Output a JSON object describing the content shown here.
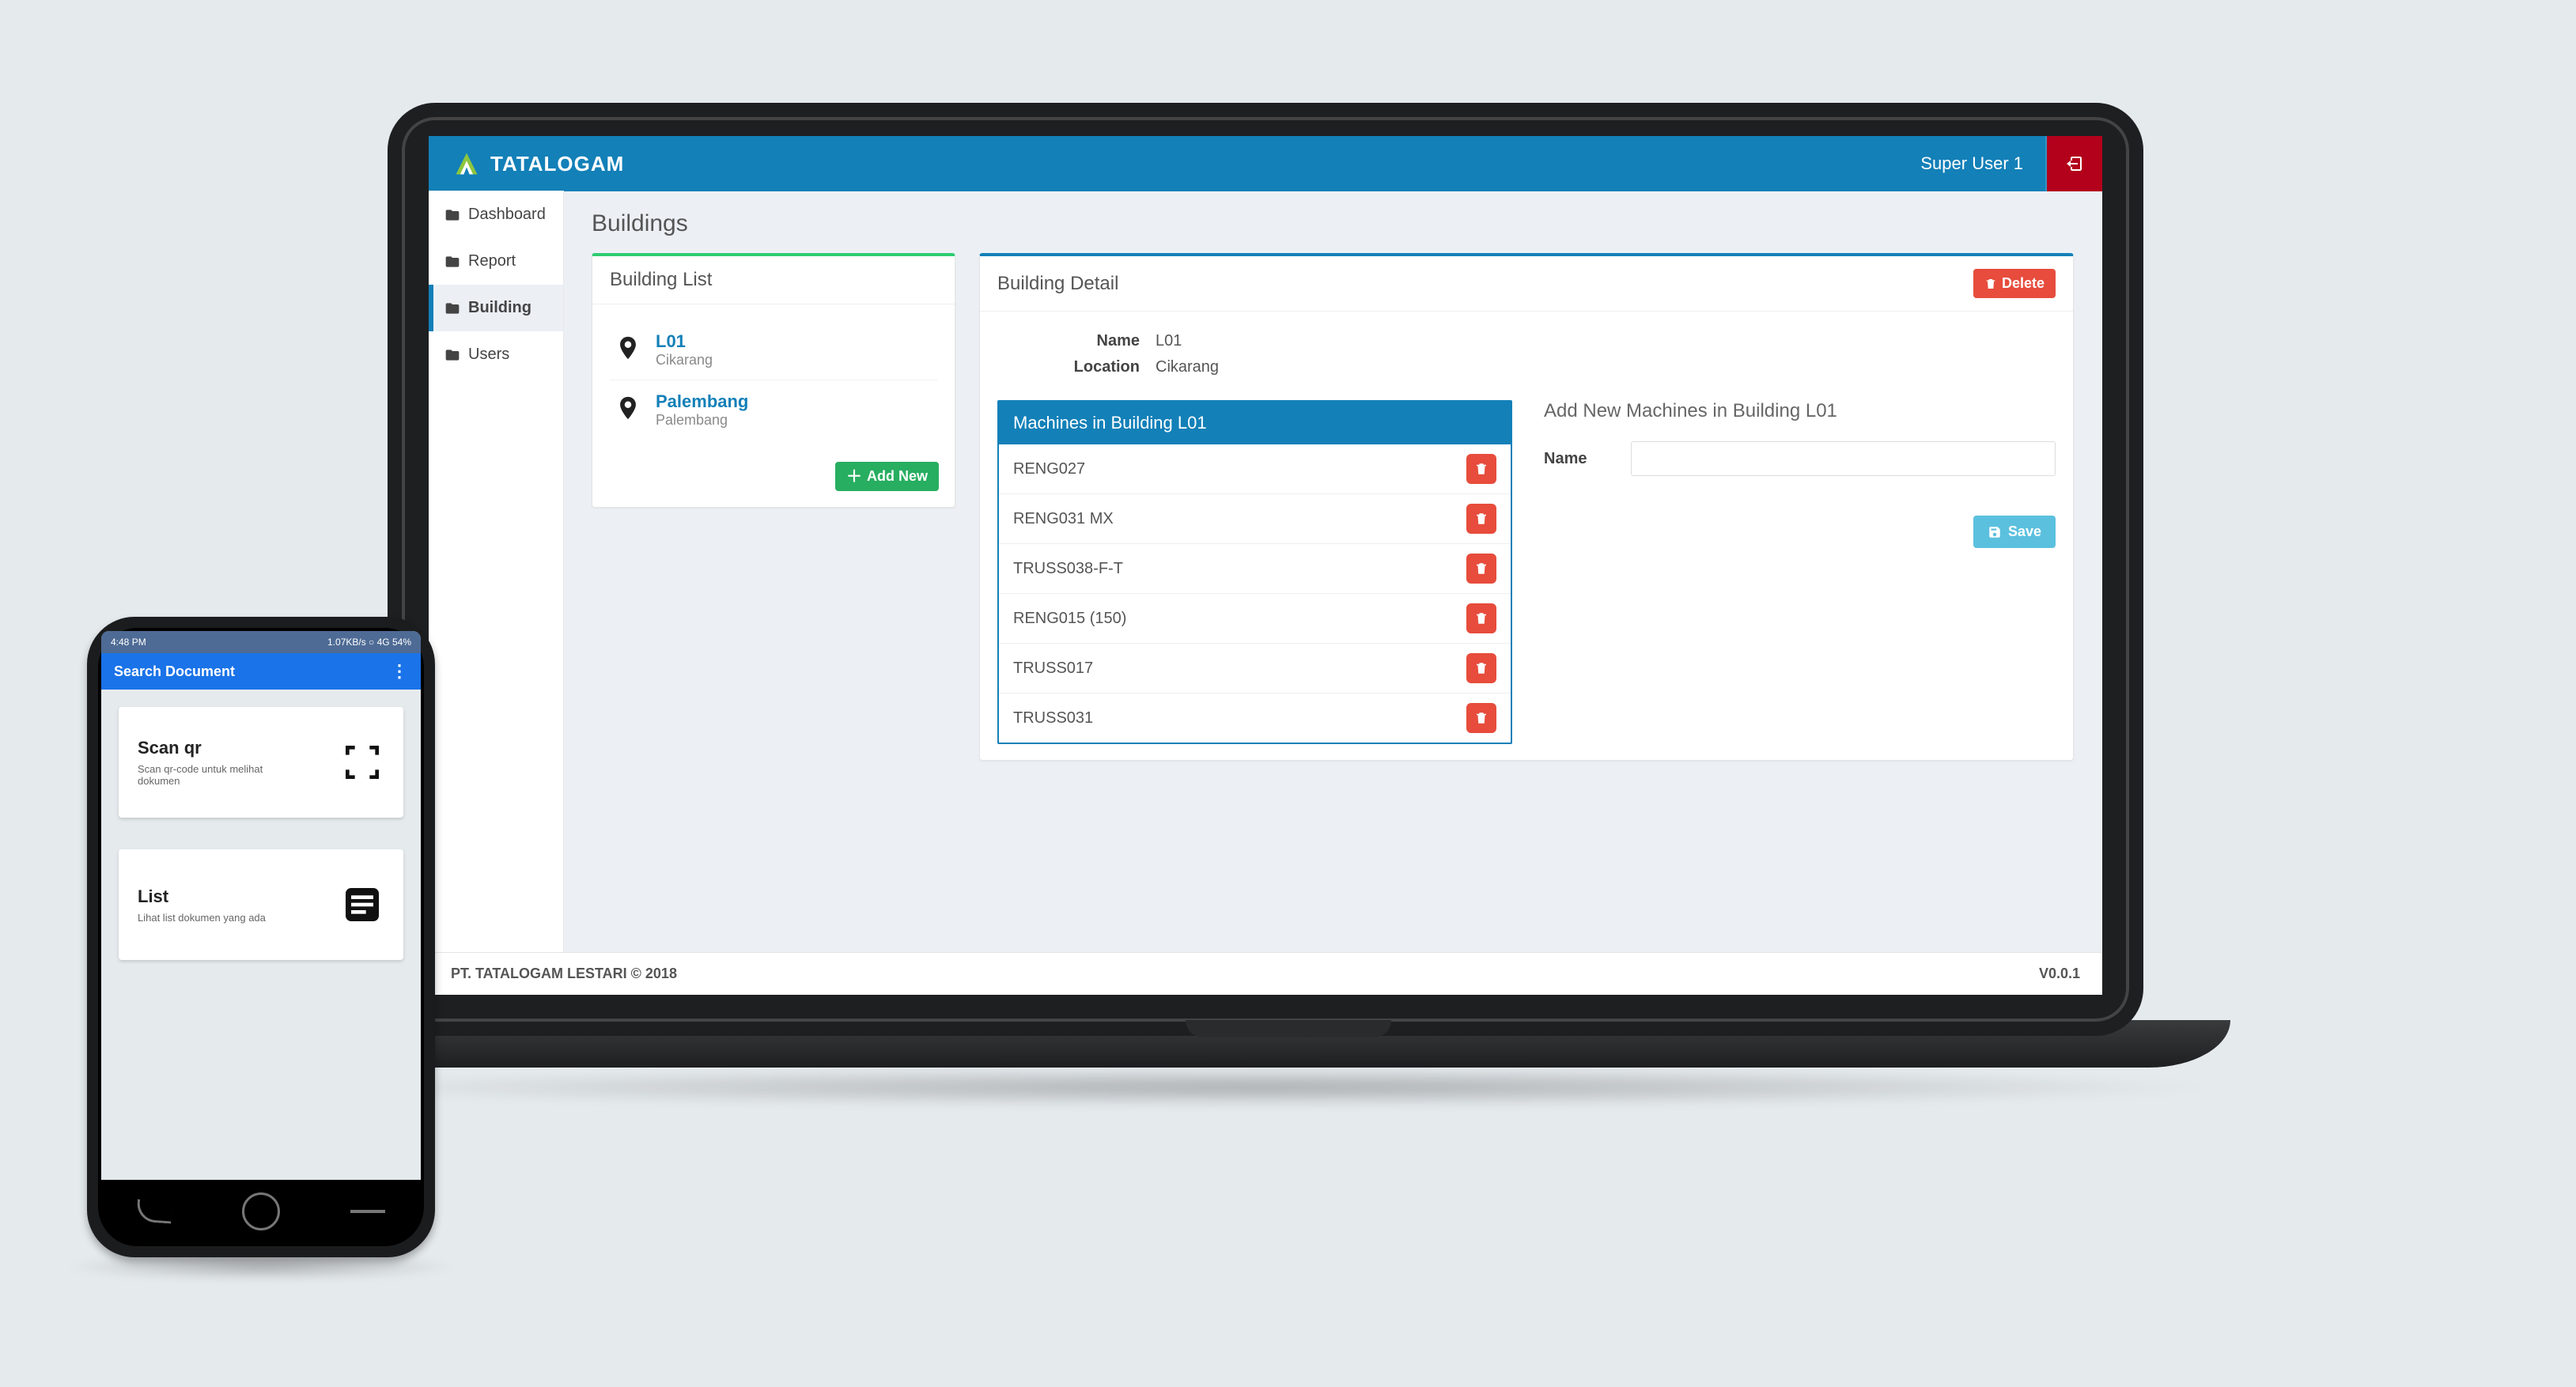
{
  "brand": "TATALOGAM",
  "topbar": {
    "user": "Super User 1"
  },
  "sidebar": [
    {
      "label": "Dashboard",
      "name": "dashboard"
    },
    {
      "label": "Report",
      "name": "report"
    },
    {
      "label": "Building",
      "name": "building",
      "active": true
    },
    {
      "label": "Users",
      "name": "users"
    }
  ],
  "page_title": "Buildings",
  "building_list": {
    "title": "Building List",
    "add_new": "Add New",
    "items": [
      {
        "name": "L01",
        "location": "Cikarang"
      },
      {
        "name": "Palembang",
        "location": "Palembang"
      }
    ]
  },
  "building_detail": {
    "title": "Building Detail",
    "delete_label": "Delete",
    "labels": {
      "name": "Name",
      "location": "Location"
    },
    "values": {
      "name": "L01",
      "location": "Cikarang"
    },
    "machines_panel_title": "Machines in Building L01",
    "machines": [
      "RENG027",
      "RENG031 MX",
      "TRUSS038-F-T",
      "RENG015 (150)",
      "TRUSS017",
      "TRUSS031"
    ],
    "add_machine": {
      "title": "Add New Machines in Building L01",
      "name_label": "Name",
      "name_value": "",
      "save_label": "Save"
    }
  },
  "footer": {
    "left": "PT. TATALOGAM LESTARI © 2018",
    "right": "V0.0.1"
  },
  "phone": {
    "status_left": "4:48 PM",
    "status_right": "1.07KB/s ○ 4G 54%",
    "appbar_title": "Search Document",
    "cards": [
      {
        "title": "Scan qr",
        "subtitle": "Scan qr-code untuk melihat dokumen"
      },
      {
        "title": "List",
        "subtitle": "Lihat list dokumen yang ada"
      }
    ]
  }
}
